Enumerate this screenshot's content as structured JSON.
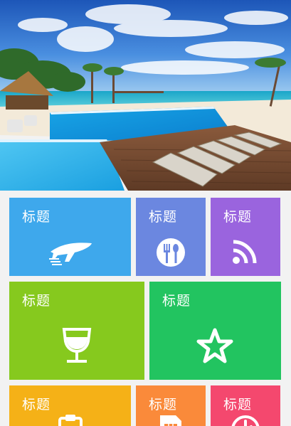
{
  "banner": {
    "icon": "beach-resort-photo"
  },
  "tiles": {
    "flights": {
      "label": "标题",
      "icon": "airplane-icon",
      "color": "#3ea8ec"
    },
    "food": {
      "label": "标题",
      "icon": "fork-spoon-icon",
      "color": "#6b87e0"
    },
    "rss": {
      "label": "标题",
      "icon": "rss-icon",
      "color": "#9a64de"
    },
    "drinks": {
      "label": "标题",
      "icon": "wine-glass-icon",
      "color": "#86c91e"
    },
    "favorites": {
      "label": "标题",
      "icon": "star-icon",
      "color": "#22c460"
    },
    "tasks": {
      "label": "标题",
      "icon": "clipboard-icon",
      "color": "#f5b117"
    },
    "sim": {
      "label": "标题",
      "icon": "sim-card-icon",
      "color": "#fa8a3a"
    },
    "clock": {
      "label": "标题",
      "icon": "clock-icon",
      "color": "#f4486e"
    }
  }
}
